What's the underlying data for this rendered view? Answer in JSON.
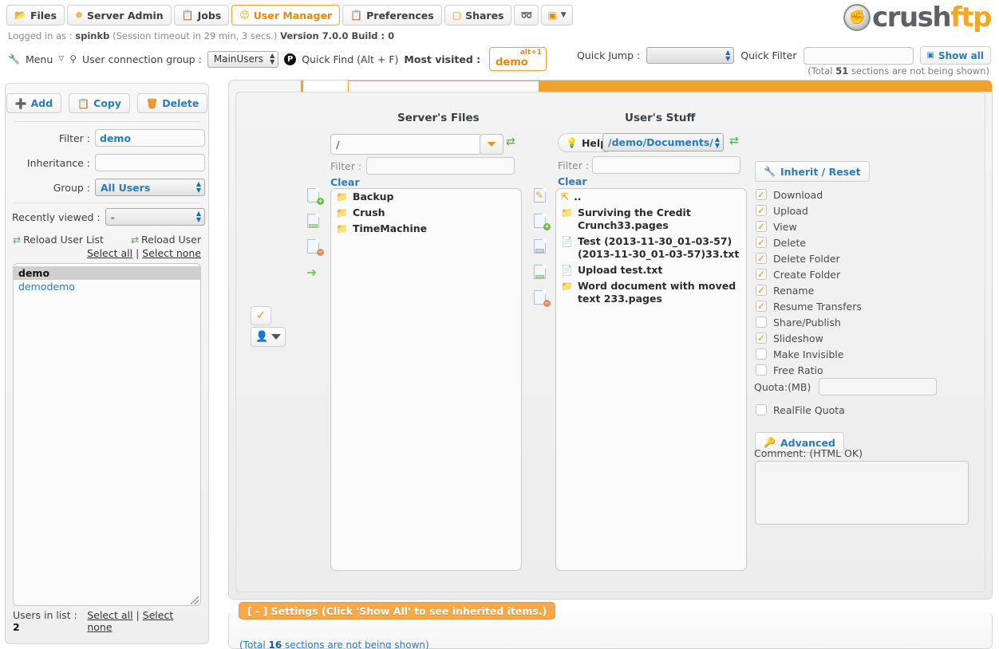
{
  "header": {
    "tabs": [
      {
        "label": "Files",
        "icon": "folder-open-icon",
        "active": false
      },
      {
        "label": "Server Admin",
        "icon": "gear-icon",
        "active": false
      },
      {
        "label": "Jobs",
        "icon": "clipboard-icon",
        "active": false
      },
      {
        "label": "User Manager",
        "icon": "user-icon",
        "active": true
      },
      {
        "label": "Preferences",
        "icon": "clipboard-icon",
        "active": false
      },
      {
        "label": "Shares",
        "icon": "book-icon",
        "active": false
      }
    ],
    "icon_tabs": [
      {
        "name": "lock-icon",
        "glyph": "⚿"
      },
      {
        "name": "image-icon",
        "glyph": "▣"
      }
    ],
    "logo": {
      "first": "crush",
      "second": "ftp"
    },
    "info": {
      "logged_in_prefix": "Logged in as :",
      "user": "spinkb",
      "session": "(Session timeout in 29 min, 3 secs.)",
      "version": "Version 7.0.0 Build : 0"
    },
    "controls": {
      "menu_label": "Menu",
      "connection_group_label": "User connection group :",
      "connection_group_value": "MainUsers",
      "quick_find_label": "Quick Find (Alt + F)",
      "quick_find_badge": "P",
      "most_visited_label": "Most visited :",
      "most_visited_shortcut": "alt+1",
      "most_visited_name": "demo"
    },
    "right": {
      "quick_jump_label": "Quick Jump :",
      "quick_jump_value": "",
      "quick_filter_label": "Quick Filter",
      "quick_filter_value": "",
      "show_all_label": "Show all",
      "sections_note_prefix": "(Total ",
      "sections_note_count": "51",
      "sections_note_suffix": " sections are not being shown)"
    }
  },
  "sidebar": {
    "buttons": [
      {
        "label": "Add",
        "icon": "plus-icon",
        "glyph": "✚"
      },
      {
        "label": "Copy",
        "icon": "copy-icon",
        "glyph": "❐"
      },
      {
        "label": "Delete",
        "icon": "trash-icon",
        "glyph": "Ὕ1"
      }
    ],
    "filter_label": "Filter :",
    "filter_value": "demo",
    "inheritance_label": "Inheritance :",
    "inheritance_value": "",
    "group_label": "Group :",
    "group_value": "All Users",
    "recently_viewed_label": "Recently viewed :",
    "recently_viewed_value": "-",
    "reload_user_list_label": "Reload User List",
    "reload_user_label": "Reload User",
    "select_all_label": "Select all",
    "select_divider": "|",
    "select_none_label": "Select none",
    "users": [
      {
        "name": "demo",
        "selected": true
      },
      {
        "name": "demodemo",
        "selected": false
      }
    ],
    "users_in_list_label": "Users in list :",
    "users_in_list_count": "2",
    "foot_select_all": "Select all",
    "foot_select_none": "Select none"
  },
  "server_files": {
    "title": "Server's Files",
    "path_value": "/",
    "filter_label": "Filter :",
    "filter_value": "",
    "clear_label": "Clear",
    "items": [
      {
        "name": "Backup",
        "type": "folder"
      },
      {
        "name": "Crush",
        "type": "folder"
      },
      {
        "name": "TimeMachine",
        "type": "folder"
      }
    ],
    "left_icons": [
      {
        "name": "new-file-icon"
      },
      {
        "name": "file-icon"
      },
      {
        "name": "delete-file-icon"
      },
      {
        "name": "move-right-icon"
      }
    ]
  },
  "user_stuff": {
    "title": "User's Stuff",
    "help_label": "Help",
    "path_value": "/demo/Documents/",
    "filter_label": "Filter :",
    "filter_value": "",
    "clear_label": "Clear",
    "items": [
      {
        "name": "..",
        "type": "up"
      },
      {
        "name": "Surviving the Credit Crunch33.pages",
        "type": "folder"
      },
      {
        "name": "Test (2013-11-30_01-03-57) (2013-11-30_01-03-57)33.txt",
        "type": "file"
      },
      {
        "name": "Upload test.txt",
        "type": "file"
      },
      {
        "name": "Word document with moved text 233.pages",
        "type": "folder"
      }
    ],
    "side_icons": [
      {
        "name": "edit-icon"
      },
      {
        "name": "new-file-icon"
      },
      {
        "name": "archive-icon"
      },
      {
        "name": "file-icon"
      },
      {
        "name": "delete-file-icon"
      }
    ]
  },
  "middle_controls": {
    "check-toggle": "check-toggle-button",
    "user-dropdown": "user-dropdown-button"
  },
  "permissions": {
    "inherit_reset_label": "Inherit / Reset",
    "items": [
      {
        "label": "Download",
        "checked": true
      },
      {
        "label": "Upload",
        "checked": true
      },
      {
        "label": "View",
        "checked": true
      },
      {
        "label": "Delete",
        "checked": true
      },
      {
        "label": "Delete Folder",
        "checked": true
      },
      {
        "label": "Create Folder",
        "checked": true
      },
      {
        "label": "Rename",
        "checked": true
      },
      {
        "label": "Resume Transfers",
        "checked": true
      },
      {
        "label": "Share/Publish",
        "checked": false
      },
      {
        "label": "Slideshow",
        "checked": true
      },
      {
        "label": "Make Invisible",
        "checked": false
      },
      {
        "label": "Free Ratio",
        "checked": false
      }
    ],
    "quota_label": "Quota:(MB)",
    "quota_value": "",
    "realfile_quota_label": "RealFile Quota",
    "realfile_quota_checked": false,
    "advanced_label": "Advanced",
    "comment_label": "Comment: (HTML OK)",
    "comment_value": ""
  },
  "settings_panel": {
    "tag_label": "[ - ] Settings (Click 'Show All' to see inherited items.)",
    "note_prefix": "(Total ",
    "note_count": "16",
    "note_suffix": " sections are not being shown)"
  }
}
